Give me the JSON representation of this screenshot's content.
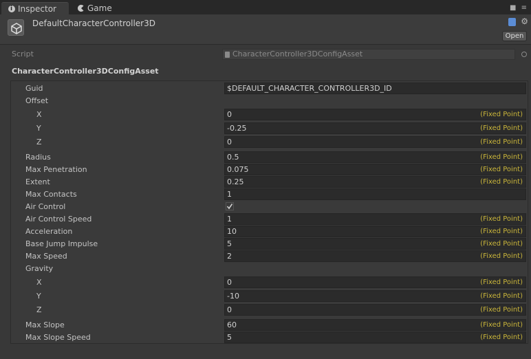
{
  "tabs": [
    {
      "label": "Inspector",
      "icon": "info-icon",
      "active": true
    },
    {
      "label": "Game",
      "icon": "pacman-icon",
      "active": false
    }
  ],
  "header": {
    "title": "DefaultCharacterController3D",
    "open_label": "Open"
  },
  "script": {
    "label": "Script",
    "value": "CharacterController3DConfigAsset"
  },
  "section_title": "CharacterController3DConfigAsset",
  "fixed_point_tag": "(Fixed Point)",
  "properties": [
    {
      "label": "Guid",
      "value": "$DEFAULT_CHARACTER_CONTROLLER3D_ID",
      "fp": false
    },
    {
      "label": "Offset"
    },
    {
      "label": "X",
      "value": "0",
      "fp": true
    },
    {
      "label": "Y",
      "value": "-0.25",
      "fp": true
    },
    {
      "label": "Z",
      "value": "0",
      "fp": true
    },
    {
      "label": "Radius",
      "value": "0.5",
      "fp": true
    },
    {
      "label": "Max Penetration",
      "value": "0.075",
      "fp": true
    },
    {
      "label": "Extent",
      "value": "0.25",
      "fp": true
    },
    {
      "label": "Max Contacts",
      "value": "1",
      "fp": false
    },
    {
      "label": "Air Control",
      "checked": true
    },
    {
      "label": "Air Control Speed",
      "value": "1",
      "fp": true
    },
    {
      "label": "Acceleration",
      "value": "10",
      "fp": true
    },
    {
      "label": "Base Jump Impulse",
      "value": "5",
      "fp": true
    },
    {
      "label": "Max Speed",
      "value": "2",
      "fp": true
    },
    {
      "label": "Gravity"
    },
    {
      "label": "X",
      "value": "0",
      "fp": true
    },
    {
      "label": "Y",
      "value": "-10",
      "fp": true
    },
    {
      "label": "Z",
      "value": "0",
      "fp": true
    },
    {
      "label": "Max Slope",
      "value": "60",
      "fp": true
    },
    {
      "label": "Max Slope Speed",
      "value": "5",
      "fp": true
    }
  ],
  "colors": {
    "fixed_point": "#c8b43a",
    "background": "#383838",
    "field": "#2b2b2b"
  }
}
